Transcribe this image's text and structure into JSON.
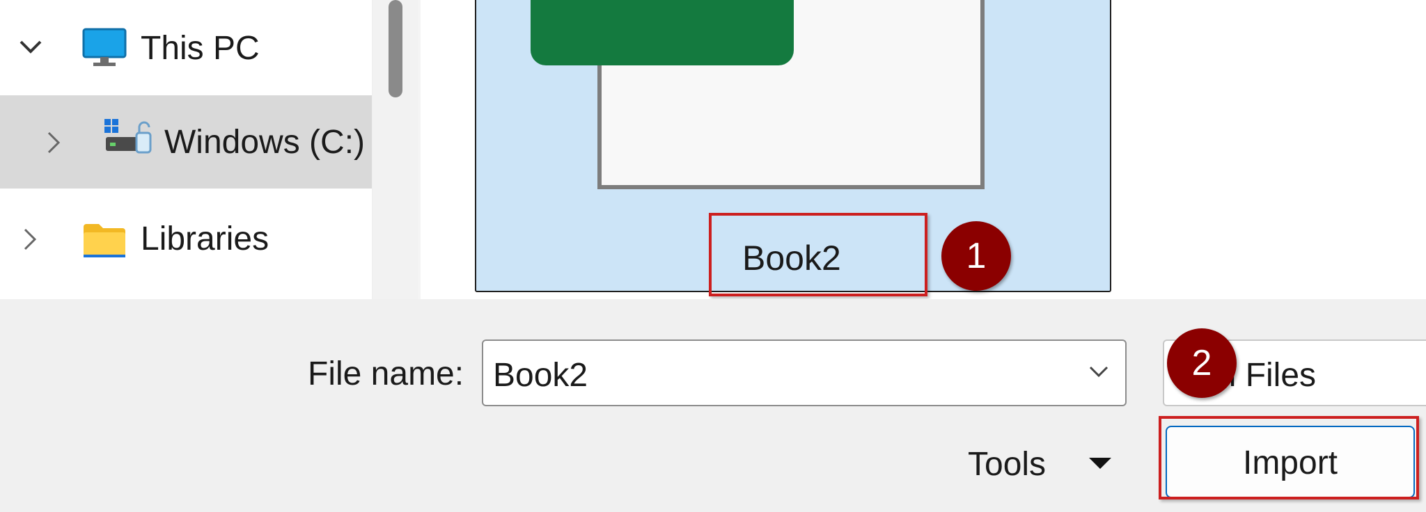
{
  "nav": {
    "items": [
      {
        "label": "This PC",
        "expanded": true,
        "icon": "monitor-icon"
      },
      {
        "label": "Windows (C:)",
        "expanded": false,
        "icon": "drive-icon",
        "selected": true
      },
      {
        "label": "Libraries",
        "expanded": false,
        "icon": "folder-icon"
      }
    ]
  },
  "content": {
    "file": {
      "name": "Book2",
      "type_icon": "excel-icon"
    }
  },
  "annotations": {
    "step1": "1",
    "step2": "2"
  },
  "bottom": {
    "file_name_label": "File name:",
    "file_name_value": "Book2",
    "file_type_value": "el Files",
    "tools_label": "Tools",
    "import_label": "Import"
  },
  "colors": {
    "selection": "#cce4f7",
    "excel_green": "#147a3f",
    "annotation_red": "#cc1f1f",
    "badge": "#8b0000",
    "accent": "#0067c0"
  }
}
